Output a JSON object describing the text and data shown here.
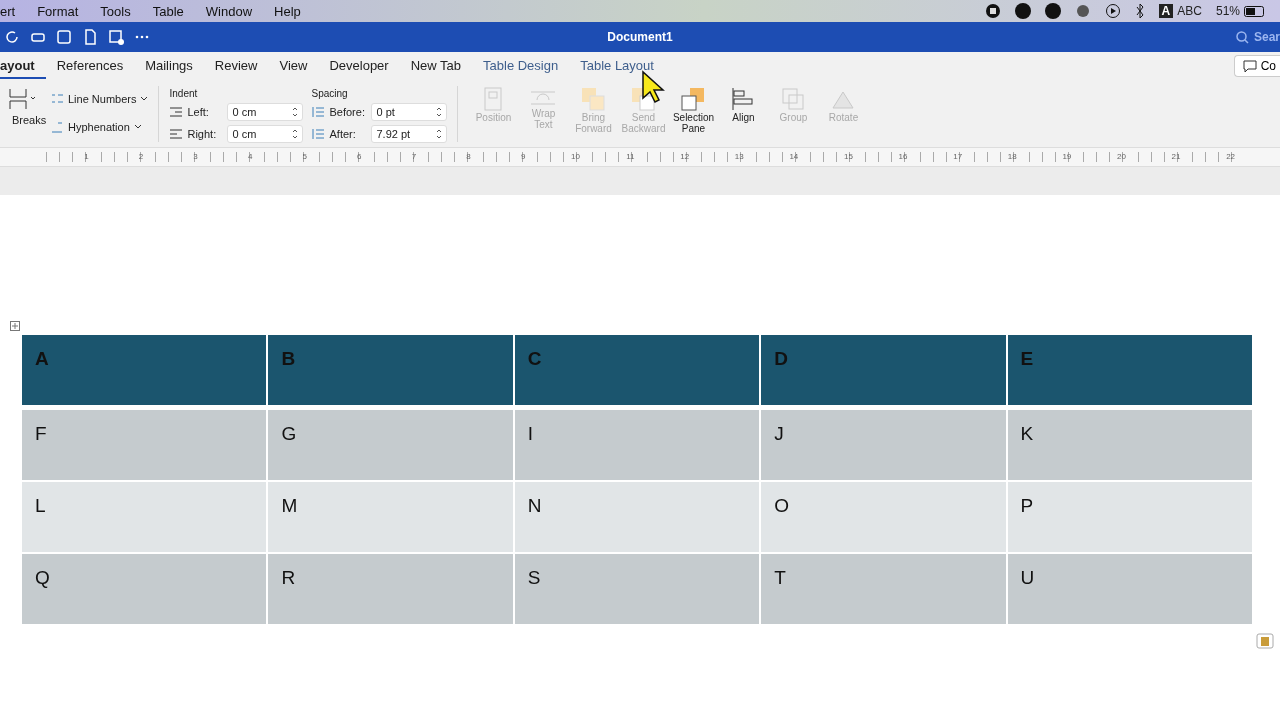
{
  "menubar": {
    "menus": [
      "ert",
      "Format",
      "Tools",
      "Table",
      "Window",
      "Help"
    ],
    "input_label": "A",
    "input_source": "ABC",
    "battery": "51%"
  },
  "titlebar": {
    "title": "Document1",
    "search": {
      "placeholder": "Sear"
    }
  },
  "tabs": [
    {
      "label": "ayout",
      "selected": true,
      "kind": "normal"
    },
    {
      "label": "References",
      "selected": false,
      "kind": "normal"
    },
    {
      "label": "Mailings",
      "selected": false,
      "kind": "normal"
    },
    {
      "label": "Review",
      "selected": false,
      "kind": "normal"
    },
    {
      "label": "View",
      "selected": false,
      "kind": "normal"
    },
    {
      "label": "Developer",
      "selected": false,
      "kind": "normal"
    },
    {
      "label": "New Tab",
      "selected": false,
      "kind": "normal"
    },
    {
      "label": "Table Design",
      "selected": false,
      "kind": "contextual"
    },
    {
      "label": "Table Layout",
      "selected": false,
      "kind": "contextual"
    }
  ],
  "comments_button": "Co",
  "ribbon": {
    "breaks": "Breaks",
    "line_numbers": "Line Numbers",
    "hyphenation": "Hyphenation",
    "indent": {
      "title": "Indent",
      "left_label": "Left:",
      "left": "0 cm",
      "right_label": "Right:",
      "right": "0 cm"
    },
    "spacing": {
      "title": "Spacing",
      "before_label": "Before:",
      "before": "0 pt",
      "after_label": "After:",
      "after": "7.92 pt"
    },
    "arrange": [
      {
        "label": [
          "Position"
        ],
        "disabled": true,
        "kind": "position"
      },
      {
        "label": [
          "Wrap",
          "Text"
        ],
        "disabled": true,
        "kind": "wrap"
      },
      {
        "label": [
          "Bring",
          "Forward"
        ],
        "disabled": true,
        "kind": "bring"
      },
      {
        "label": [
          "Send",
          "Backward"
        ],
        "disabled": true,
        "kind": "send"
      },
      {
        "label": [
          "Selection",
          "Pane"
        ],
        "disabled": false,
        "kind": "selection"
      },
      {
        "label": [
          "Align"
        ],
        "disabled": false,
        "kind": "align"
      },
      {
        "label": [
          "Group"
        ],
        "disabled": true,
        "kind": "group"
      },
      {
        "label": [
          "Rotate"
        ],
        "disabled": true,
        "kind": "rotate"
      }
    ]
  },
  "ruler": [
    "1",
    "2",
    "3",
    "4",
    "5",
    "6",
    "7",
    "8",
    "9",
    "10",
    "11",
    "12",
    "13",
    "14",
    "15",
    "16",
    "17",
    "18",
    "19",
    "20",
    "21",
    "22"
  ],
  "table": {
    "header": [
      "A",
      "B",
      "C",
      "D",
      "E"
    ],
    "rows": [
      [
        "F",
        "G",
        "I",
        "J",
        "K"
      ],
      [
        "L",
        "M",
        "N",
        "O",
        "P"
      ],
      [
        "Q",
        "R",
        "S",
        "T",
        "U"
      ]
    ]
  }
}
